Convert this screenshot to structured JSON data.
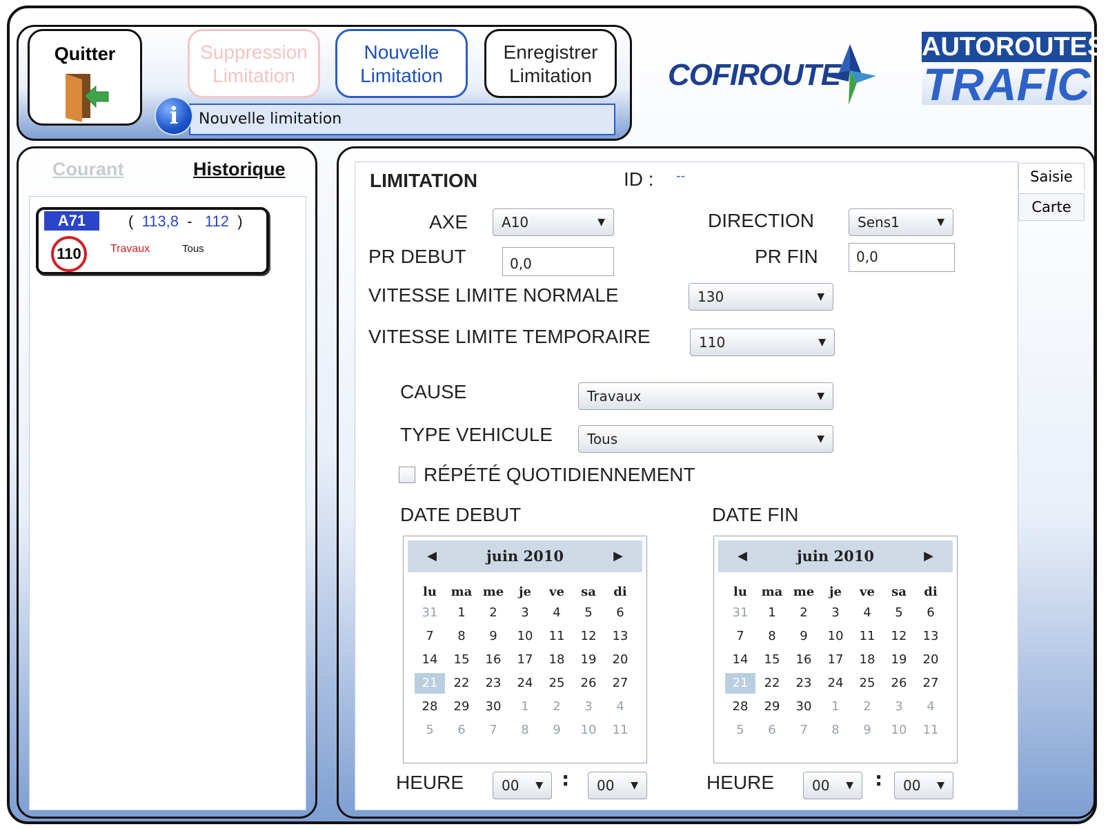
{
  "toolbar": {
    "quit_label": "Quitter",
    "delete_label_1": "Suppression",
    "delete_label_2": "Limitation",
    "new_label_1": "Nouvelle",
    "new_label_2": "Limitation",
    "save_label_1": "Enregistrer",
    "save_label_2": "Limitation",
    "info_text": "Nouvelle limitation",
    "info_icon": "info-icon",
    "quit_icon": "door-exit-icon"
  },
  "logos": {
    "cofiroute": "COFIROUTE",
    "autoroutes": "AUTOROUTES",
    "trafic": "TRAFIC"
  },
  "left": {
    "tab_current": "Courant",
    "tab_history": "Historique",
    "card": {
      "road": "A71",
      "pr_open": "(",
      "pr_start": "113,8",
      "pr_sep": "-",
      "pr_end": "112",
      "pr_close": ")",
      "speed": "110",
      "cause": "Travaux",
      "vehicle": "Tous"
    }
  },
  "form": {
    "title": "LIMITATION",
    "id_label": "ID :",
    "id_value": "--",
    "tabs": [
      "Saisie",
      "Carte"
    ],
    "axe_label": "AXE",
    "axe_value": "A10",
    "direction_label": "DIRECTION",
    "direction_value": "Sens1",
    "pr_debut_label": "PR DEBUT",
    "pr_debut_value": "0,0",
    "pr_fin_label": "PR FIN",
    "pr_fin_value": "0,0",
    "vitesse_normale_label": "VITESSE LIMITE NORMALE",
    "vitesse_normale_value": "130",
    "vitesse_temp_label": "VITESSE LIMITE TEMPORAIRE",
    "vitesse_temp_value": "110",
    "cause_label": "CAUSE",
    "cause_value": "Travaux",
    "type_label": "TYPE VEHICULE",
    "type_value": "Tous",
    "repeat_label": "RÉPÉTÉ QUOTIDIENNEMENT",
    "repeat_checked": false,
    "date_debut_label": "DATE DEBUT",
    "date_fin_label": "DATE FIN",
    "heure_label": "HEURE",
    "start_hour": "00",
    "start_minute": "00",
    "end_hour": "00",
    "end_minute": "00",
    "colon": ":"
  },
  "calendar": {
    "month": "juin 2010",
    "prev_glyph": "◀",
    "next_glyph": "▶",
    "weekdays": [
      "lu",
      "ma",
      "me",
      "je",
      "ve",
      "sa",
      "di"
    ],
    "selected_day": "21",
    "weeks": [
      [
        {
          "d": "31",
          "o": true
        },
        {
          "d": "1"
        },
        {
          "d": "2"
        },
        {
          "d": "3"
        },
        {
          "d": "4"
        },
        {
          "d": "5"
        },
        {
          "d": "6"
        }
      ],
      [
        {
          "d": "7"
        },
        {
          "d": "8"
        },
        {
          "d": "9"
        },
        {
          "d": "10"
        },
        {
          "d": "11"
        },
        {
          "d": "12"
        },
        {
          "d": "13"
        }
      ],
      [
        {
          "d": "14"
        },
        {
          "d": "15"
        },
        {
          "d": "16"
        },
        {
          "d": "17"
        },
        {
          "d": "18"
        },
        {
          "d": "19"
        },
        {
          "d": "20"
        }
      ],
      [
        {
          "d": "21",
          "s": true
        },
        {
          "d": "22"
        },
        {
          "d": "23"
        },
        {
          "d": "24"
        },
        {
          "d": "25"
        },
        {
          "d": "26"
        },
        {
          "d": "27"
        }
      ],
      [
        {
          "d": "28"
        },
        {
          "d": "29"
        },
        {
          "d": "30"
        },
        {
          "d": "1",
          "o": true
        },
        {
          "d": "2",
          "o": true
        },
        {
          "d": "3",
          "o": true
        },
        {
          "d": "4",
          "o": true
        }
      ],
      [
        {
          "d": "5",
          "o": true
        },
        {
          "d": "6",
          "o": true
        },
        {
          "d": "7",
          "o": true
        },
        {
          "d": "8",
          "o": true
        },
        {
          "d": "9",
          "o": true
        },
        {
          "d": "10",
          "o": true
        },
        {
          "d": "11",
          "o": true
        }
      ]
    ]
  },
  "colors": {
    "accent_blue": "#1c4fbd",
    "road_badge": "#2a45c9",
    "speed_ring": "#d41f26",
    "selected_day": "#b9cfe0"
  }
}
